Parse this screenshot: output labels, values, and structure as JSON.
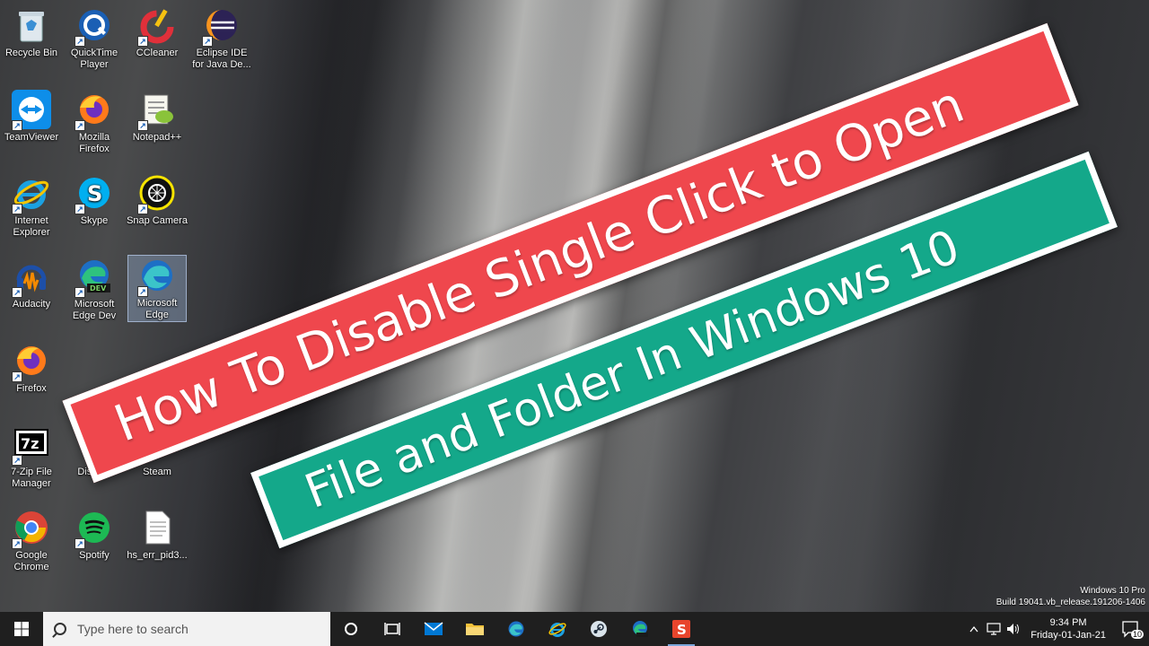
{
  "desktop": {
    "icons": [
      {
        "label": "Recycle Bin"
      },
      {
        "label": "QuickTime Player"
      },
      {
        "label": "CCleaner"
      },
      {
        "label": "Eclipse IDE for Java De..."
      },
      {
        "label": "TeamViewer"
      },
      {
        "label": "Mozilla Firefox"
      },
      {
        "label": "Notepad++"
      },
      {
        "label": "Internet Explorer"
      },
      {
        "label": "Skype"
      },
      {
        "label": "Snap Camera"
      },
      {
        "label": "Audacity"
      },
      {
        "label": "Microsoft Edge Dev"
      },
      {
        "label": "Microsoft Edge"
      },
      {
        "label": "Firefox"
      },
      {
        "label": "7-Zip File Manager"
      },
      {
        "label": "Discord"
      },
      {
        "label": "Steam"
      },
      {
        "label": "Google Chrome"
      },
      {
        "label": "Spotify"
      },
      {
        "label": "hs_err_pid3..."
      }
    ]
  },
  "banner": {
    "line1": "How To Disable Single Click to Open",
    "line2": "File and Folder In Windows 10"
  },
  "watermark": {
    "edition": "Windows 10 Pro",
    "build": "Build 19041.vb_release.191206-1406"
  },
  "taskbar": {
    "search_placeholder": "Type here to search",
    "time": "9:34 PM",
    "date": "Friday-01-Jan-21",
    "notification_count": "10"
  },
  "colors": {
    "banner_red": "#ef474d",
    "banner_green": "#14a88a",
    "taskbar": "#1f1f1f"
  }
}
